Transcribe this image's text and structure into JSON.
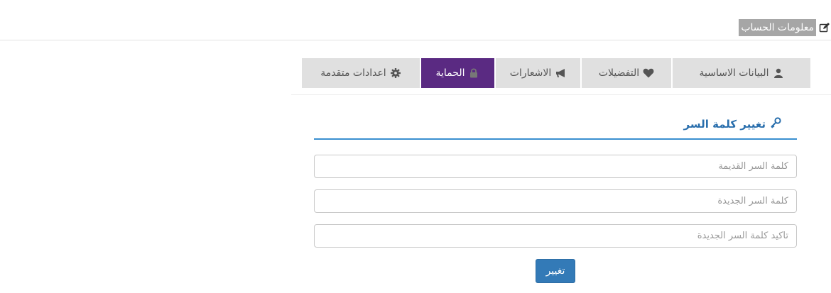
{
  "header": {
    "title": "معلومات الحساب",
    "icon": "edit-icon"
  },
  "tabs": [
    {
      "label": "البيانات الاساسية",
      "icon": "user-icon",
      "active": false
    },
    {
      "label": "التفضيلات",
      "icon": "heart-icon",
      "active": false
    },
    {
      "label": "الاشعارات",
      "icon": "megaphone-icon",
      "active": false
    },
    {
      "label": "الحماية",
      "icon": "lock-icon",
      "active": true
    },
    {
      "label": "اعدادات متقدمة",
      "icon": "gear-icon",
      "active": false
    }
  ],
  "section": {
    "title": "تغيير كلمة السر",
    "icon": "key-icon"
  },
  "form": {
    "old_password_placeholder": "كلمة السر القديمة",
    "new_password_placeholder": "كلمة السر الجديدة",
    "confirm_password_placeholder": "تاكيد كلمة السر الجديدة",
    "submit_label": "تغيير"
  },
  "colors": {
    "active_tab": "#5a2a82",
    "tab_bg": "#e0e0e0",
    "accent": "#337ab7",
    "section_rule": "#3a8fd0"
  }
}
